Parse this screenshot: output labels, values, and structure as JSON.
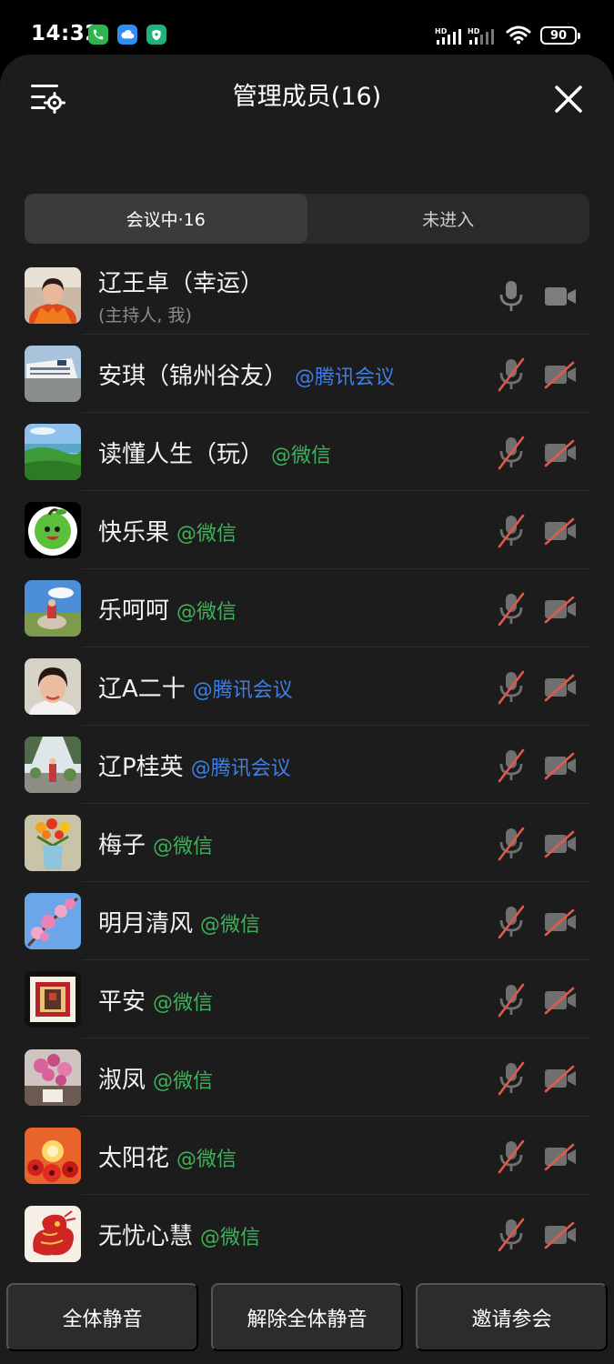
{
  "status_bar": {
    "time": "14:32",
    "battery": "90",
    "network_1": "HD",
    "network_2": "HD",
    "app_icons": [
      "phone-icon",
      "cloud-icon",
      "shield-icon"
    ]
  },
  "header": {
    "title": "管理成员(16)"
  },
  "tabs": {
    "in_meeting": "会议中·16",
    "not_joined": "未进入"
  },
  "members": [
    {
      "name": "辽王卓（幸运）",
      "tag": "",
      "sub": "(主持人, 我)",
      "mic": "on",
      "cam": "on"
    },
    {
      "name": "安琪（锦州谷友）",
      "tag": "@腾讯会议",
      "sub": "",
      "mic": "off",
      "cam": "off"
    },
    {
      "name": "读懂人生（玩）",
      "tag": "@微信",
      "sub": "",
      "mic": "off",
      "cam": "off"
    },
    {
      "name": "快乐果",
      "tag": "@微信",
      "sub": "",
      "mic": "off",
      "cam": "off"
    },
    {
      "name": "乐呵呵",
      "tag": "@微信",
      "sub": "",
      "mic": "off",
      "cam": "off"
    },
    {
      "name": "辽A二十",
      "tag": "@腾讯会议",
      "sub": "",
      "mic": "off",
      "cam": "off"
    },
    {
      "name": "辽P桂英",
      "tag": "@腾讯会议",
      "sub": "",
      "mic": "off",
      "cam": "off"
    },
    {
      "name": "梅子",
      "tag": "@微信",
      "sub": "",
      "mic": "off",
      "cam": "off"
    },
    {
      "name": "明月清风",
      "tag": "@微信",
      "sub": "",
      "mic": "off",
      "cam": "off"
    },
    {
      "name": "平安",
      "tag": "@微信",
      "sub": "",
      "mic": "off",
      "cam": "off"
    },
    {
      "name": "淑凤",
      "tag": "@微信",
      "sub": "",
      "mic": "off",
      "cam": "off"
    },
    {
      "name": "太阳花",
      "tag": "@微信",
      "sub": "",
      "mic": "off",
      "cam": "off"
    },
    {
      "name": "无忧心慧",
      "tag": "@微信",
      "sub": "",
      "mic": "off",
      "cam": "off"
    }
  ],
  "bottom": {
    "mute_all": "全体静音",
    "unmute_all": "解除全体静音",
    "invite": "邀请参会"
  },
  "colors": {
    "background": "#1c1c1c",
    "wechat_tag": "#3fb15a",
    "tencent_tag": "#3d7fe6",
    "muted_slash": "#e05a4a"
  }
}
